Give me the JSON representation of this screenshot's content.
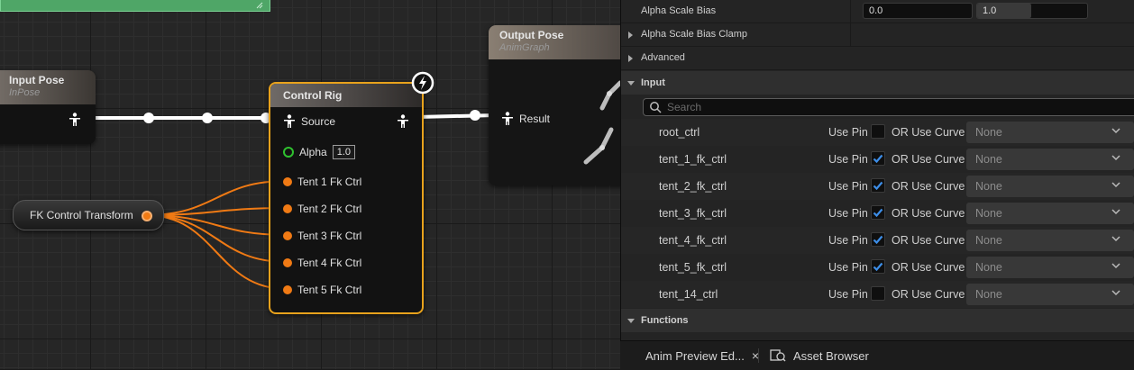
{
  "graph": {
    "input_pose": {
      "title": "Input Pose",
      "subtitle": "InPose"
    },
    "output_pose": {
      "title": "Output Pose",
      "subtitle": "AnimGraph",
      "pin": "Result"
    },
    "control_rig": {
      "title": "Control Rig",
      "source_pin": "Source",
      "alpha_label": "Alpha",
      "alpha_value": "1.0",
      "pins": [
        "Tent 1 Fk Ctrl",
        "Tent 2 Fk Ctrl",
        "Tent 3 Fk Ctrl",
        "Tent 4 Fk Ctrl",
        "Tent 5 Fk Ctrl"
      ]
    },
    "fk_node": {
      "label": "FK Control Transform"
    }
  },
  "details": {
    "alpha_scale_bias": {
      "label": "Alpha Scale Bias",
      "min": "0.0",
      "max": "1.0"
    },
    "alpha_scale_bias_clamp": "Alpha Scale Bias Clamp",
    "advanced": "Advanced",
    "input_section": "Input",
    "search_placeholder": "Search",
    "use_pin_label": "Use Pin",
    "or_use_curve_label": "OR Use Curve",
    "inputs": [
      {
        "name": "root_ctrl",
        "use_pin": false,
        "curve": "None"
      },
      {
        "name": "tent_1_fk_ctrl",
        "use_pin": true,
        "curve": "None"
      },
      {
        "name": "tent_2_fk_ctrl",
        "use_pin": true,
        "curve": "None"
      },
      {
        "name": "tent_3_fk_ctrl",
        "use_pin": true,
        "curve": "None"
      },
      {
        "name": "tent_4_fk_ctrl",
        "use_pin": true,
        "curve": "None"
      },
      {
        "name": "tent_5_fk_ctrl",
        "use_pin": true,
        "curve": "None"
      },
      {
        "name": "tent_14_ctrl",
        "use_pin": false,
        "curve": "None"
      }
    ],
    "functions_section": "Functions"
  },
  "tabs": [
    {
      "label": "Anim Preview Ed...",
      "close": "×"
    },
    {
      "label": "Asset Browser"
    }
  ],
  "colors": {
    "exec_pin": "#f07a14",
    "selection": "#e8a21c",
    "checkbox_accent": "#3d8ee8",
    "alpha_pin": "#2fc12f"
  }
}
